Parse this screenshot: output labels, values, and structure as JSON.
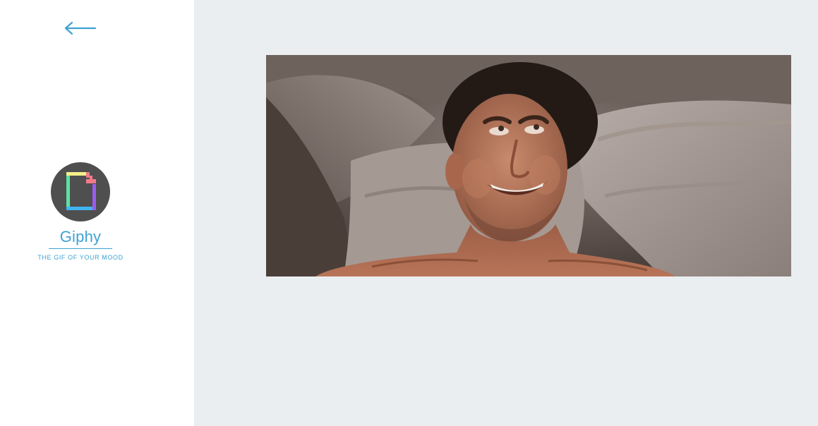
{
  "sidebar": {
    "back_icon": "arrow-left-icon",
    "brand": {
      "logo_icon": "giphy-logo-icon",
      "name": "Giphy",
      "tagline": "THE GIF OF YOUR MOOD"
    }
  },
  "colors": {
    "accent": "#3ea2d4",
    "sidebar_bg": "#ffffff",
    "content_bg": "#eaeef0",
    "avatar_bg": "#4f4f4f"
  },
  "main": {
    "gif_icon": "gif-image"
  }
}
